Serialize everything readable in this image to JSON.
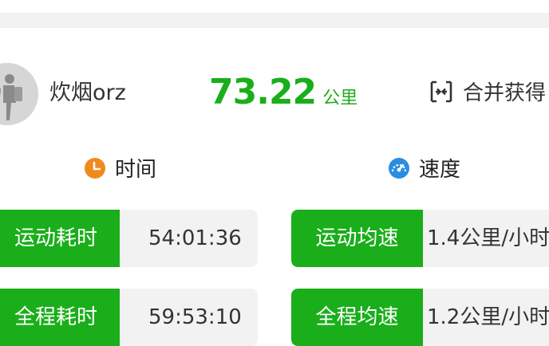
{
  "user": {
    "name": "炊烟orz"
  },
  "summary": {
    "distance": "73.22",
    "distance_unit": "公里",
    "merge_label": "合并获得"
  },
  "sections": {
    "time": {
      "title": "时间",
      "icon": "clock-icon",
      "icon_color": "#f08a1c"
    },
    "speed": {
      "title": "速度",
      "icon": "speedometer-icon",
      "icon_color": "#2b8de0"
    }
  },
  "stats": {
    "exercise_time": {
      "label": "运动耗时",
      "value": "54:01:36"
    },
    "total_time": {
      "label": "全程耗时",
      "value": "59:53:10"
    },
    "exercise_avg_speed": {
      "label": "运动均速",
      "value": "1.4公里/小时"
    },
    "total_avg_speed": {
      "label": "全程均速",
      "value": "1.2公里/小时"
    }
  },
  "colors": {
    "accent": "#1aae1a",
    "card_bg": "#f2f2f2"
  }
}
